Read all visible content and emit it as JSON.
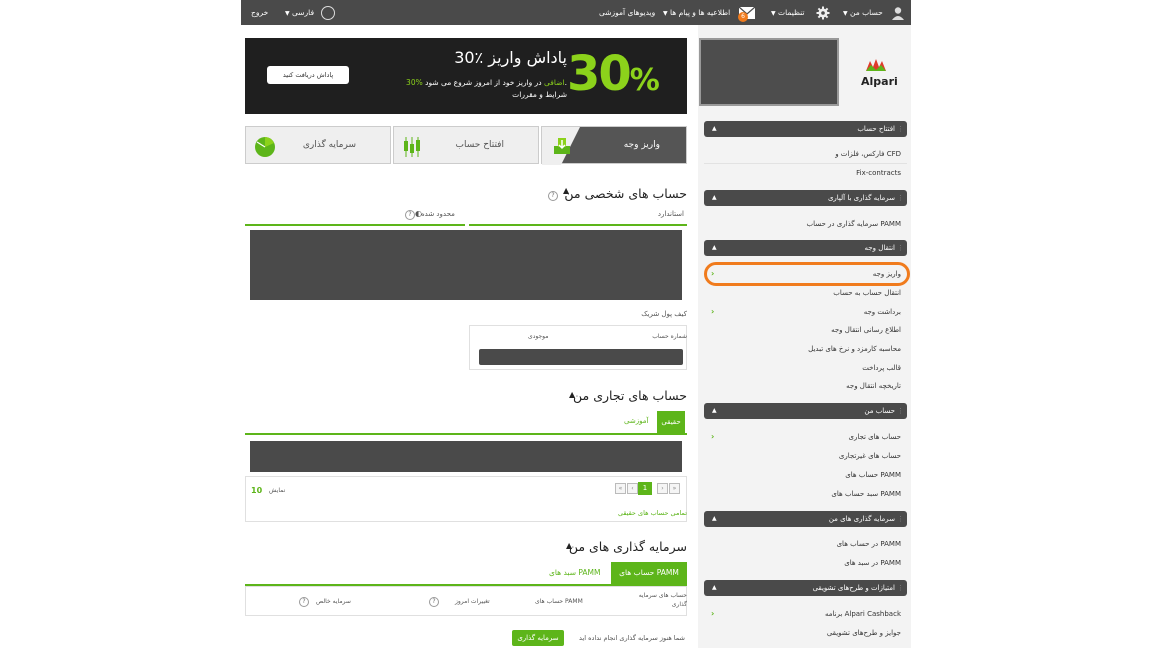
{
  "topbar": {
    "logout": "خروج",
    "language": "فارسی",
    "videos": "ویدیوهای آموزشی",
    "notifications": "اطلاعیه ها و پیام ها",
    "notifications_count": "6",
    "settings": "تنظیمات",
    "my_account": "حساب من"
  },
  "banner": {
    "big_number": "30",
    "big_percent": "%",
    "title": "30٪ پاداش واریز",
    "line1_highlight": "30% اضافی",
    "line1_rest": " در واریز خود از امروز شروع می شود.",
    "line2": "شرایط و مقررات",
    "cta": "پاداش دریافت کنید"
  },
  "tiles": [
    {
      "label": "واریز وجه",
      "icon": "deposit-icon"
    },
    {
      "label": "افتتاح حساب",
      "icon": "candles-icon"
    },
    {
      "label": "سرمایه گذاری",
      "icon": "pie-icon"
    }
  ],
  "personal": {
    "title": "حساب های شخصی من",
    "col_standard": "استاندارد",
    "col_limited": "محدود شده",
    "wallet_title": "کیف پول شریک",
    "wallet_col_number": "شماره حساب",
    "wallet_col_balance": "موجودی"
  },
  "trading": {
    "title": "حساب های تجاری من",
    "tab_real": "حقیقی",
    "tab_demo": "آموزشی",
    "per_page_label": "نمایش",
    "per_page_value": "10",
    "current_page": "1",
    "all_link": "تمامی حساب های حقیقی"
  },
  "investments": {
    "title": "سرمایه گذاری های من",
    "tab_pamm_accounts": "حساب های PAMM",
    "tab_pamm_portfolios": "سبد های PAMM",
    "col_investment_accounts": "حساب های سرمایه گذاری",
    "col_pamm_account": "حساب های PAMM",
    "col_today_change": "تغییرات امروز",
    "col_net_investment": "سرمایه خالص",
    "empty_message": "شما هنوز سرمایه گذاری انجام نداده اید",
    "invest_button": "سرمایه گذاری"
  },
  "sidebar": {
    "logo": "Alpari",
    "sections": [
      {
        "title": "افتتاح حساب",
        "items": [
          "فارکس، فلزات و CFD",
          "Fix-contracts"
        ]
      },
      {
        "title": "سرمایه گذاری با آلپاری",
        "items": [
          "سرمایه گذاری در حساب PAMM"
        ]
      },
      {
        "title": "انتقال وجه",
        "items": [
          "واریز وجه",
          "انتقال حساب به حساب",
          "برداشت وجه",
          "اطلاع رسانی انتقال وجه",
          "محاسبه کارمزد و نرخ های تبدیل",
          "قالب پرداخت",
          "تاریخچه انتقال وجه"
        ]
      },
      {
        "title": "حساب من",
        "items": [
          "حساب های تجاری",
          "حساب های غیرتجاری",
          "حساب های PAMM",
          "سبد حساب های PAMM"
        ]
      },
      {
        "title": "سرمایه گذاری های من",
        "items": [
          "در حساب های PAMM",
          "در سبد های PAMM"
        ]
      },
      {
        "title": "امتیازات و طرح‌های تشویقی",
        "items": [
          "برنامه Alpari Cashback",
          "جوایز و طرح‌های تشویقی"
        ]
      }
    ]
  },
  "colors": {
    "accent": "#5db51a",
    "dark": "#4a4a4a",
    "highlight": "#f07b1d"
  }
}
